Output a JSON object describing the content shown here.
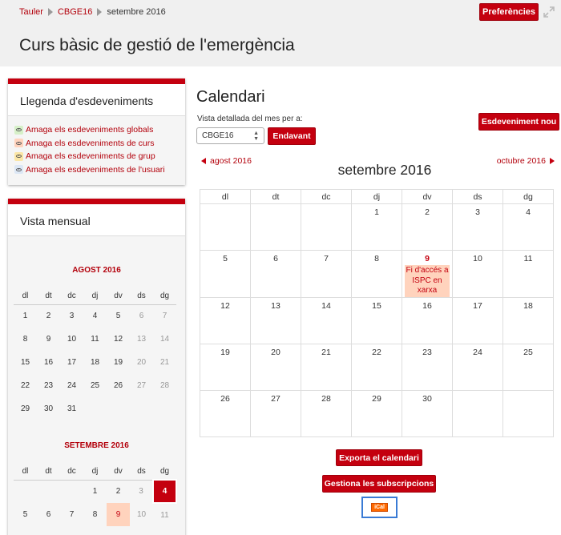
{
  "breadcrumb": [
    "Tauler",
    "CBGE16",
    "setembre 2016"
  ],
  "header": {
    "preferences_label": "Preferències",
    "page_title": "Curs bàsic de gestió de l'emergència"
  },
  "legend": {
    "title": "Llegenda d'esdeveniments",
    "items": [
      {
        "label": "Amaga els esdeveniments globals",
        "color": "#d6f0c8"
      },
      {
        "label": "Amaga els esdeveniments de curs",
        "color": "#ffd3bd"
      },
      {
        "label": "Amaga els esdeveniments de grup",
        "color": "#fbe6a6"
      },
      {
        "label": "Amaga els esdeveniments de l'usuari",
        "color": "#dce7f5"
      }
    ]
  },
  "mini_calendar": {
    "title": "Vista mensual",
    "weekdays": [
      "dl",
      "dt",
      "dc",
      "dj",
      "dv",
      "ds",
      "dg"
    ],
    "months": [
      {
        "name": "AGOST 2016",
        "weeks": [
          [
            "1",
            "2",
            "3",
            "4",
            "5",
            "6",
            "7"
          ],
          [
            "8",
            "9",
            "10",
            "11",
            "12",
            "13",
            "14"
          ],
          [
            "15",
            "16",
            "17",
            "18",
            "19",
            "20",
            "21"
          ],
          [
            "22",
            "23",
            "24",
            "25",
            "26",
            "27",
            "28"
          ],
          [
            "29",
            "30",
            "31",
            "",
            "",
            "",
            ""
          ]
        ]
      },
      {
        "name": "SETEMBRE 2016",
        "weeks": [
          [
            "",
            "",
            "",
            "1",
            "2",
            "3",
            "4"
          ],
          [
            "5",
            "6",
            "7",
            "8",
            "9",
            "10",
            "11"
          ]
        ]
      }
    ]
  },
  "main": {
    "title": "Calendari",
    "view_label": "Vista detallada del mes per a:",
    "selected_course": "CBGE16",
    "go_label": "Endavant",
    "new_event_label": "Esdeveniment nou",
    "prev_month": "agost 2016",
    "next_month": "octubre 2016",
    "month_title": "setembre 2016",
    "weekdays": [
      "dl",
      "dt",
      "dc",
      "dj",
      "dv",
      "ds",
      "dg"
    ],
    "weeks": [
      [
        "",
        "",
        "",
        "1",
        "2",
        "3",
        "4"
      ],
      [
        "5",
        "6",
        "7",
        "8",
        "9",
        "10",
        "11"
      ],
      [
        "12",
        "13",
        "14",
        "15",
        "16",
        "17",
        "18"
      ],
      [
        "19",
        "20",
        "21",
        "22",
        "23",
        "24",
        "25"
      ],
      [
        "26",
        "27",
        "28",
        "29",
        "30",
        "",
        ""
      ]
    ],
    "event": {
      "day": "9",
      "label": "Fi d'accés a ISPC en xarxa"
    },
    "export_label": "Exporta el calendari",
    "subscriptions_label": "Gestiona les subscripcions",
    "ical_label": "iCal"
  }
}
